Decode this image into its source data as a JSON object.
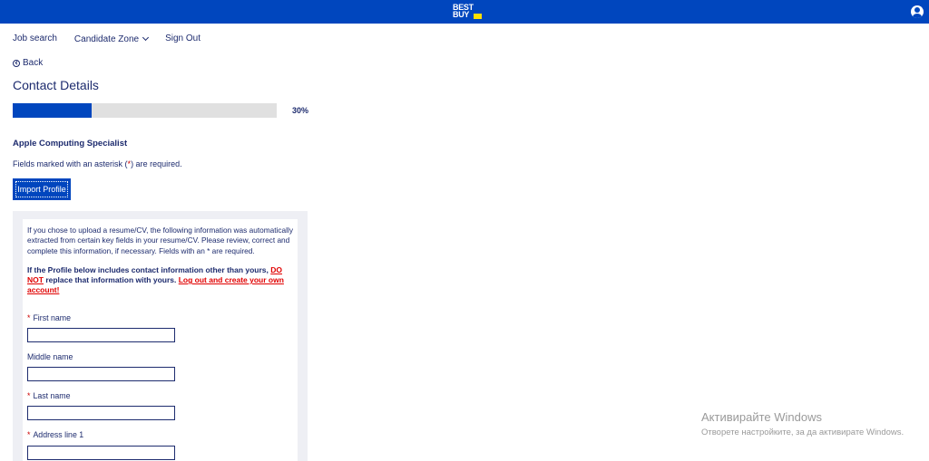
{
  "header": {
    "logo_text": "BEST BUY",
    "brand_color": "#0046be",
    "logo_tag_color": "#ffe000",
    "user_icon": "user-icon"
  },
  "nav": {
    "job_search": "Job search",
    "candidate_zone": "Candidate Zone",
    "sign_out": "Sign Out"
  },
  "back_label": "Back",
  "page_title": "Contact Details",
  "progress": {
    "value": 0.3,
    "label": "30%"
  },
  "job_title": "Apple Computing Specialist",
  "required_note": {
    "before": "Fields marked with an asterisk (",
    "asterisk": "*",
    "after": ") are required."
  },
  "import_button": "Import Profile",
  "panel": {
    "info": "If you chose to upload a resume/CV, the following information was automatically extracted from certain key fields in your resume/CV. Please review, correct and complete this information, if necessary. Fields with an * are required.",
    "warning_part1": "If the Profile below includes contact information other than yours, ",
    "warning_red1": "DO NOT",
    "warning_part2": " replace that information with yours. ",
    "warning_red2": "Log out and create your own account!",
    "fields": {
      "first_name": {
        "label": "First name",
        "required": "*",
        "value": ""
      },
      "middle_name": {
        "label": "Middle name",
        "value": ""
      },
      "last_name": {
        "label": "Last name",
        "required": "*",
        "value": ""
      },
      "address_line_1": {
        "label": "Address line 1",
        "required": "*",
        "value": ""
      }
    }
  },
  "activation": {
    "title": "Активирайте Windows",
    "subtitle": "Отворете настройките, за да активирате Windows."
  }
}
